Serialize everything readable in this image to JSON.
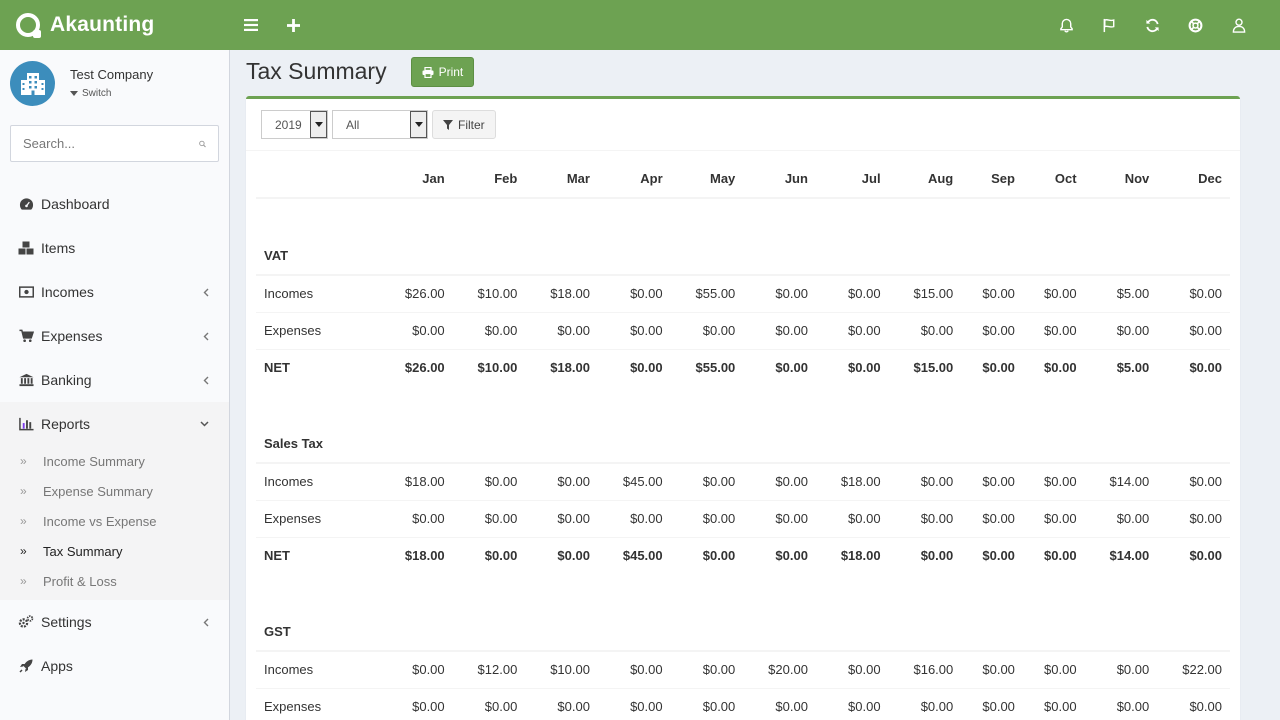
{
  "app": {
    "name": "Akaunting"
  },
  "company": {
    "name": "Test Company",
    "switch_label": "Switch"
  },
  "search": {
    "placeholder": "Search..."
  },
  "nav": {
    "items": [
      {
        "label": "Dashboard",
        "icon": "dashboard-icon"
      },
      {
        "label": "Items",
        "icon": "cubes-icon"
      },
      {
        "label": "Incomes",
        "icon": "money-icon"
      },
      {
        "label": "Expenses",
        "icon": "shopping-cart-icon"
      },
      {
        "label": "Banking",
        "icon": "university-icon"
      },
      {
        "label": "Reports",
        "icon": "bar-chart-icon"
      },
      {
        "label": "Settings",
        "icon": "gears-icon"
      },
      {
        "label": "Apps",
        "icon": "rocket-icon"
      }
    ],
    "reports_sub": [
      {
        "label": "Income Summary"
      },
      {
        "label": "Expense Summary"
      },
      {
        "label": "Income vs Expense"
      },
      {
        "label": "Tax Summary"
      },
      {
        "label": "Profit & Loss"
      }
    ]
  },
  "page": {
    "title": "Tax Summary",
    "print_label": "Print"
  },
  "filters": {
    "year": "2019",
    "status": "All",
    "filter_label": "Filter"
  },
  "table": {
    "months": [
      "Jan",
      "Feb",
      "Mar",
      "Apr",
      "May",
      "Jun",
      "Jul",
      "Aug",
      "Sep",
      "Oct",
      "Nov",
      "Dec"
    ],
    "sections": [
      {
        "name": "VAT",
        "rows": [
          {
            "label": "Incomes",
            "values": [
              "$26.00",
              "$10.00",
              "$18.00",
              "$0.00",
              "$55.00",
              "$0.00",
              "$0.00",
              "$15.00",
              "$0.00",
              "$0.00",
              "$5.00",
              "$0.00"
            ]
          },
          {
            "label": "Expenses",
            "values": [
              "$0.00",
              "$0.00",
              "$0.00",
              "$0.00",
              "$0.00",
              "$0.00",
              "$0.00",
              "$0.00",
              "$0.00",
              "$0.00",
              "$0.00",
              "$0.00"
            ]
          },
          {
            "label": "NET",
            "values": [
              "$26.00",
              "$10.00",
              "$18.00",
              "$0.00",
              "$55.00",
              "$0.00",
              "$0.00",
              "$15.00",
              "$0.00",
              "$0.00",
              "$5.00",
              "$0.00"
            ]
          }
        ]
      },
      {
        "name": "Sales Tax",
        "rows": [
          {
            "label": "Incomes",
            "values": [
              "$18.00",
              "$0.00",
              "$0.00",
              "$45.00",
              "$0.00",
              "$0.00",
              "$18.00",
              "$0.00",
              "$0.00",
              "$0.00",
              "$14.00",
              "$0.00"
            ]
          },
          {
            "label": "Expenses",
            "values": [
              "$0.00",
              "$0.00",
              "$0.00",
              "$0.00",
              "$0.00",
              "$0.00",
              "$0.00",
              "$0.00",
              "$0.00",
              "$0.00",
              "$0.00",
              "$0.00"
            ]
          },
          {
            "label": "NET",
            "values": [
              "$18.00",
              "$0.00",
              "$0.00",
              "$45.00",
              "$0.00",
              "$0.00",
              "$18.00",
              "$0.00",
              "$0.00",
              "$0.00",
              "$14.00",
              "$0.00"
            ]
          }
        ]
      },
      {
        "name": "GST",
        "rows": [
          {
            "label": "Incomes",
            "values": [
              "$0.00",
              "$12.00",
              "$10.00",
              "$0.00",
              "$0.00",
              "$20.00",
              "$0.00",
              "$16.00",
              "$0.00",
              "$0.00",
              "$0.00",
              "$22.00"
            ]
          },
          {
            "label": "Expenses",
            "values": [
              "$0.00",
              "$0.00",
              "$0.00",
              "$0.00",
              "$0.00",
              "$0.00",
              "$0.00",
              "$0.00",
              "$0.00",
              "$0.00",
              "$0.00",
              "$0.00"
            ]
          }
        ]
      }
    ]
  },
  "colors": {
    "brand": "#6da252",
    "avatar": "#3c8dbc"
  }
}
